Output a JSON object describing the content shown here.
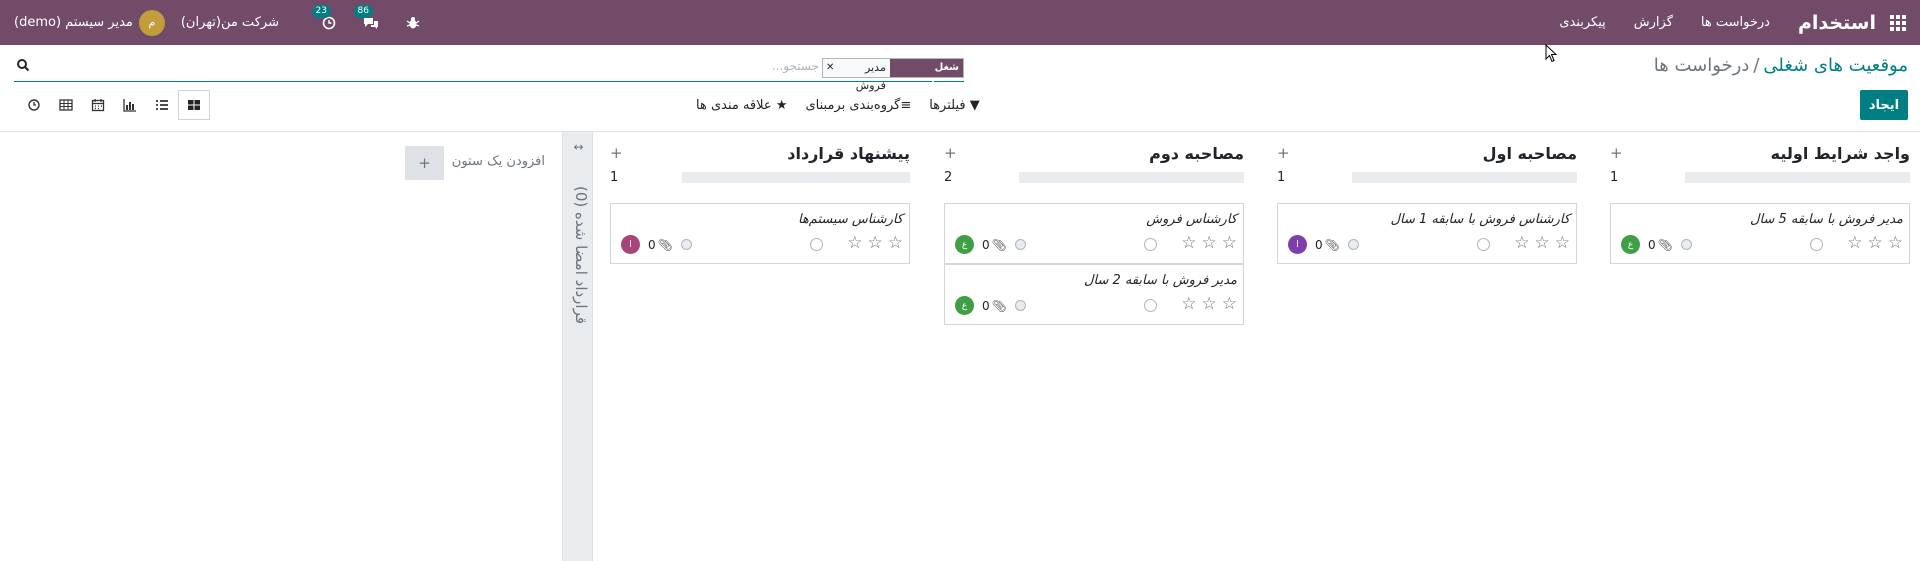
{
  "navbar": {
    "brand": "استخدام",
    "menu": [
      "درخواست ها",
      "گزارش",
      "پیکربندی"
    ],
    "user_name": "مدیر سیستم (demo)",
    "user_initial": "م",
    "company": "شرکت من(تهران)",
    "chat_badge": "86",
    "activity_badge": "23"
  },
  "breadcrumb": {
    "parent": "موقعیت های شغلی",
    "current": "درخواست ها"
  },
  "search": {
    "facet_label": "شغل درخواستی",
    "facet_value": "مدیر فروش",
    "placeholder": "جستجو..."
  },
  "toolbar": {
    "create_label": "ایجاد",
    "filters_label": "فیلترها",
    "groupby_label": "گروه‌بندی برمبنای",
    "favorites_label": "علاقه مندی ها"
  },
  "kanban": {
    "columns": [
      {
        "title": "واجد شرایط اولیه",
        "count": "1",
        "cards": [
          {
            "title": "مدیر فروش با سابقه 5 سال",
            "attachments": "0",
            "avatar_initial": "ع",
            "avatar_color": "#3f9f46"
          }
        ]
      },
      {
        "title": "مصاحبه اول",
        "count": "1",
        "cards": [
          {
            "title": "کارشناس فروش با سابقه 1 سال",
            "attachments": "0",
            "avatar_initial": "ا",
            "avatar_color": "#7e3fa8"
          }
        ]
      },
      {
        "title": "مصاحبه دوم",
        "count": "2",
        "cards": [
          {
            "title": "کارشناس فروش",
            "attachments": "0",
            "avatar_initial": "ع",
            "avatar_color": "#3f9f46"
          },
          {
            "title": "مدیر فروش با سابقه 2 سال",
            "attachments": "0",
            "avatar_initial": "ع",
            "avatar_color": "#3f9f46"
          }
        ]
      },
      {
        "title": "پیشنهاد قرارداد",
        "count": "1",
        "cards": [
          {
            "title": "کارشناس سیستم‌ها",
            "attachments": "0",
            "avatar_initial": "ا",
            "avatar_color": "#a94478"
          }
        ]
      }
    ],
    "folded_column": "قرارداد امضا شده (0)",
    "add_column_label": "افزودن یک ستون"
  },
  "colors": {
    "navbar": "#714b67",
    "accent": "#017e84"
  }
}
